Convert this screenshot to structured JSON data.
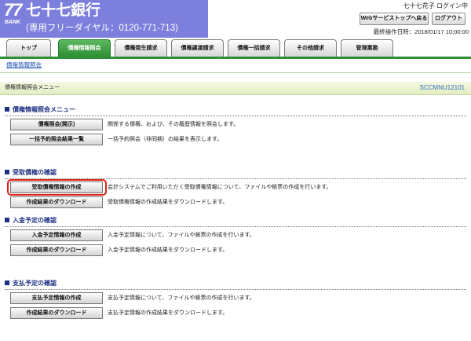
{
  "colors": {
    "brand": "#7d7fdc",
    "tab_active": "#2f8f35",
    "link": "#1a4fb5",
    "screen_id": "#2a6fbd",
    "section_heading": "#1c2f80",
    "highlight": "#e0201a"
  },
  "header": {
    "logo": {
      "number": "77",
      "sub": "BANK"
    },
    "bank_name": "七十七銀行",
    "freedial": "(専用フリーダイヤル：0120-771-713)",
    "user_status": "七十七花子 ログイン中",
    "buttons": {
      "web_top": "Webサービストップへ戻る",
      "logout": "ログアウト"
    },
    "last_operation": "最終操作日時：2018/01/17 10:00:00"
  },
  "tabs": [
    {
      "label": "トップ",
      "active": false
    },
    {
      "label": "債権情報照会",
      "active": true
    },
    {
      "label": "債権発生請求",
      "active": false
    },
    {
      "label": "債権譲渡請求",
      "active": false
    },
    {
      "label": "債権一括請求",
      "active": false
    },
    {
      "label": "その他請求",
      "active": false
    },
    {
      "label": "管理業務",
      "active": false
    }
  ],
  "subnav": {
    "current": "債権情報照会"
  },
  "page": {
    "title": "債権情報照会メニュー",
    "screen_id": "SCCMNU12101"
  },
  "sections": [
    {
      "bullet_icon": "square-bullet",
      "title": "債権情報照会メニュー",
      "items": [
        {
          "button": "債権照会(開示)",
          "description": "関係する債権、および、その履歴情報を照会します。"
        },
        {
          "button": "一括予約照会結果一覧",
          "description": "一括予約照会（非同期）の結果を表示します。"
        }
      ]
    },
    {
      "bullet_icon": "square-bullet",
      "title": "受取債権の確認",
      "items": [
        {
          "button": "受取債権情報の作成",
          "description": "会計システムでご利用いただく受取債権情報について、ファイルや帳票の作成を行います。",
          "highlighted": true
        },
        {
          "button": "作成結果のダウンロード",
          "description": "受取債権情報の作成結果をダウンロードします。"
        }
      ]
    },
    {
      "bullet_icon": "square-bullet",
      "title": "入金予定の確認",
      "items": [
        {
          "button": "入金予定情報の作成",
          "description": "入金予定情報について、ファイルや帳票の作成を行います。"
        },
        {
          "button": "作成結果のダウンロード",
          "description": "入金予定情報の作成結果をダウンロードします。"
        }
      ]
    },
    {
      "bullet_icon": "square-bullet",
      "title": "支払予定の確認",
      "items": [
        {
          "button": "支払予定情報の作成",
          "description": "支払予定情報について、ファイルや帳票の作成を行います。"
        },
        {
          "button": "作成結果のダウンロード",
          "description": "支払予定情報の作成結果をダウンロードします。"
        }
      ]
    }
  ]
}
